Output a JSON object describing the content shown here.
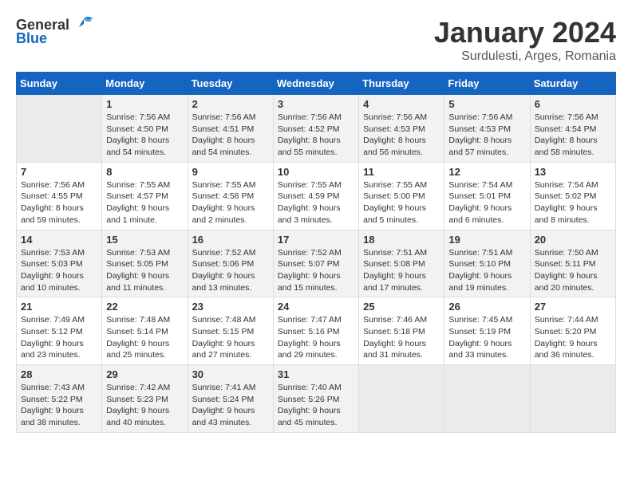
{
  "header": {
    "logo_general": "General",
    "logo_blue": "Blue",
    "title": "January 2024",
    "location": "Surdulesti, Arges, Romania"
  },
  "days_of_week": [
    "Sunday",
    "Monday",
    "Tuesday",
    "Wednesday",
    "Thursday",
    "Friday",
    "Saturday"
  ],
  "weeks": [
    [
      {
        "day": "",
        "info": ""
      },
      {
        "day": "1",
        "info": "Sunrise: 7:56 AM\nSunset: 4:50 PM\nDaylight: 8 hours\nand 54 minutes."
      },
      {
        "day": "2",
        "info": "Sunrise: 7:56 AM\nSunset: 4:51 PM\nDaylight: 8 hours\nand 54 minutes."
      },
      {
        "day": "3",
        "info": "Sunrise: 7:56 AM\nSunset: 4:52 PM\nDaylight: 8 hours\nand 55 minutes."
      },
      {
        "day": "4",
        "info": "Sunrise: 7:56 AM\nSunset: 4:53 PM\nDaylight: 8 hours\nand 56 minutes."
      },
      {
        "day": "5",
        "info": "Sunrise: 7:56 AM\nSunset: 4:53 PM\nDaylight: 8 hours\nand 57 minutes."
      },
      {
        "day": "6",
        "info": "Sunrise: 7:56 AM\nSunset: 4:54 PM\nDaylight: 8 hours\nand 58 minutes."
      }
    ],
    [
      {
        "day": "7",
        "info": "Sunrise: 7:56 AM\nSunset: 4:55 PM\nDaylight: 8 hours\nand 59 minutes."
      },
      {
        "day": "8",
        "info": "Sunrise: 7:55 AM\nSunset: 4:57 PM\nDaylight: 9 hours\nand 1 minute."
      },
      {
        "day": "9",
        "info": "Sunrise: 7:55 AM\nSunset: 4:58 PM\nDaylight: 9 hours\nand 2 minutes."
      },
      {
        "day": "10",
        "info": "Sunrise: 7:55 AM\nSunset: 4:59 PM\nDaylight: 9 hours\nand 3 minutes."
      },
      {
        "day": "11",
        "info": "Sunrise: 7:55 AM\nSunset: 5:00 PM\nDaylight: 9 hours\nand 5 minutes."
      },
      {
        "day": "12",
        "info": "Sunrise: 7:54 AM\nSunset: 5:01 PM\nDaylight: 9 hours\nand 6 minutes."
      },
      {
        "day": "13",
        "info": "Sunrise: 7:54 AM\nSunset: 5:02 PM\nDaylight: 9 hours\nand 8 minutes."
      }
    ],
    [
      {
        "day": "14",
        "info": "Sunrise: 7:53 AM\nSunset: 5:03 PM\nDaylight: 9 hours\nand 10 minutes."
      },
      {
        "day": "15",
        "info": "Sunrise: 7:53 AM\nSunset: 5:05 PM\nDaylight: 9 hours\nand 11 minutes."
      },
      {
        "day": "16",
        "info": "Sunrise: 7:52 AM\nSunset: 5:06 PM\nDaylight: 9 hours\nand 13 minutes."
      },
      {
        "day": "17",
        "info": "Sunrise: 7:52 AM\nSunset: 5:07 PM\nDaylight: 9 hours\nand 15 minutes."
      },
      {
        "day": "18",
        "info": "Sunrise: 7:51 AM\nSunset: 5:08 PM\nDaylight: 9 hours\nand 17 minutes."
      },
      {
        "day": "19",
        "info": "Sunrise: 7:51 AM\nSunset: 5:10 PM\nDaylight: 9 hours\nand 19 minutes."
      },
      {
        "day": "20",
        "info": "Sunrise: 7:50 AM\nSunset: 5:11 PM\nDaylight: 9 hours\nand 20 minutes."
      }
    ],
    [
      {
        "day": "21",
        "info": "Sunrise: 7:49 AM\nSunset: 5:12 PM\nDaylight: 9 hours\nand 23 minutes."
      },
      {
        "day": "22",
        "info": "Sunrise: 7:48 AM\nSunset: 5:14 PM\nDaylight: 9 hours\nand 25 minutes."
      },
      {
        "day": "23",
        "info": "Sunrise: 7:48 AM\nSunset: 5:15 PM\nDaylight: 9 hours\nand 27 minutes."
      },
      {
        "day": "24",
        "info": "Sunrise: 7:47 AM\nSunset: 5:16 PM\nDaylight: 9 hours\nand 29 minutes."
      },
      {
        "day": "25",
        "info": "Sunrise: 7:46 AM\nSunset: 5:18 PM\nDaylight: 9 hours\nand 31 minutes."
      },
      {
        "day": "26",
        "info": "Sunrise: 7:45 AM\nSunset: 5:19 PM\nDaylight: 9 hours\nand 33 minutes."
      },
      {
        "day": "27",
        "info": "Sunrise: 7:44 AM\nSunset: 5:20 PM\nDaylight: 9 hours\nand 36 minutes."
      }
    ],
    [
      {
        "day": "28",
        "info": "Sunrise: 7:43 AM\nSunset: 5:22 PM\nDaylight: 9 hours\nand 38 minutes."
      },
      {
        "day": "29",
        "info": "Sunrise: 7:42 AM\nSunset: 5:23 PM\nDaylight: 9 hours\nand 40 minutes."
      },
      {
        "day": "30",
        "info": "Sunrise: 7:41 AM\nSunset: 5:24 PM\nDaylight: 9 hours\nand 43 minutes."
      },
      {
        "day": "31",
        "info": "Sunrise: 7:40 AM\nSunset: 5:26 PM\nDaylight: 9 hours\nand 45 minutes."
      },
      {
        "day": "",
        "info": ""
      },
      {
        "day": "",
        "info": ""
      },
      {
        "day": "",
        "info": ""
      }
    ]
  ]
}
